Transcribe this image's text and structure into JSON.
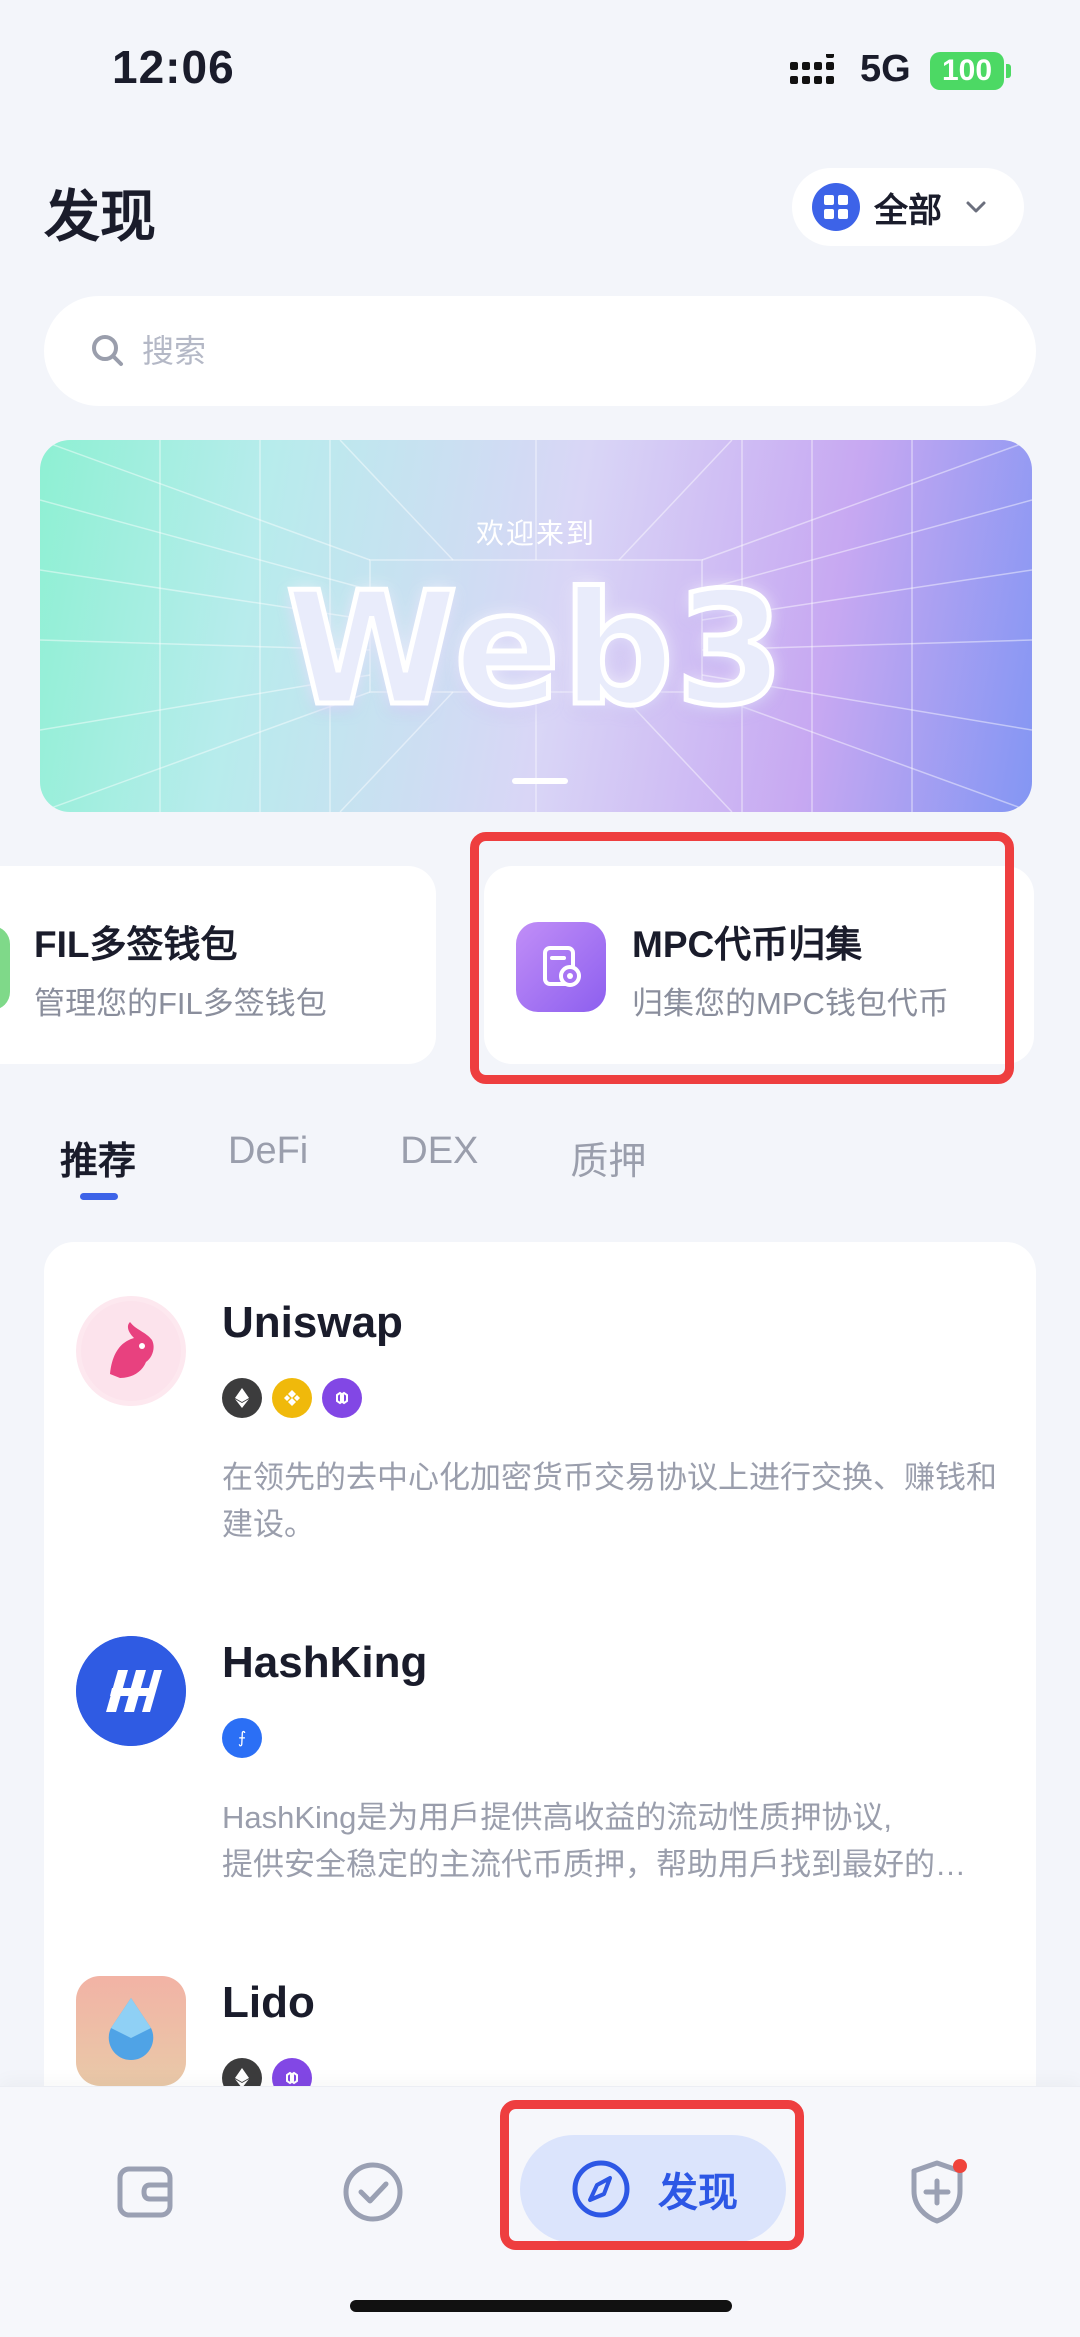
{
  "status_bar": {
    "time": "12:06",
    "network": "5G",
    "battery": "100"
  },
  "header": {
    "title": "发现",
    "filter_label": "全部"
  },
  "search": {
    "placeholder": "搜索"
  },
  "banner": {
    "subtitle": "欢迎来到",
    "title": "Web3"
  },
  "features": [
    {
      "title": "FIL多签钱包",
      "desc": "管理您的FIL多签钱包"
    },
    {
      "title": "MPC代币归集",
      "desc": "归集您的MPC钱包代币"
    }
  ],
  "tabs": [
    "推荐",
    "DeFi",
    "DEX",
    "质押"
  ],
  "dapps": [
    {
      "name": "Uniswap",
      "desc": "在领先的去中心化加密货币交易协议上进行交换、赚钱和建设。",
      "chains": [
        "eth",
        "bnb",
        "polygon"
      ]
    },
    {
      "name": "HashKing",
      "desc_line1": "HashKing是为用戶提供高收益的流动性质押协议,",
      "desc_line2": "提供安全稳定的主流代币质押，帮助用戶找到最好的收益方案。",
      "chains": [
        "fvm"
      ]
    },
    {
      "name": "Lido",
      "chains": [
        "eth",
        "polygon"
      ]
    }
  ],
  "bottom_nav": {
    "discover_label": "发现"
  },
  "colors": {
    "accent": "#3d63e8",
    "highlight": "#ee3e3f",
    "background": "#f3f5fa"
  }
}
